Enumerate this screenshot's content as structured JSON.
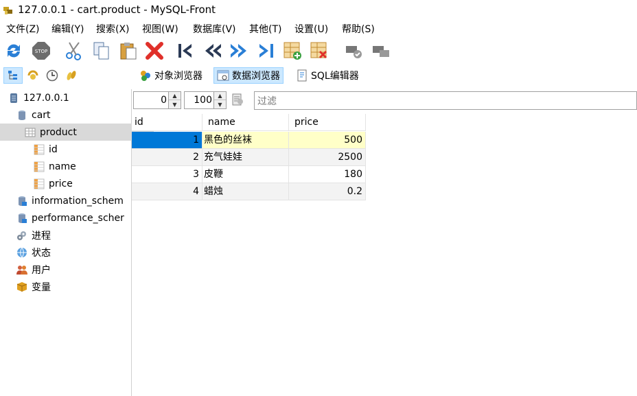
{
  "window": {
    "title": "127.0.0.1 - cart.product - MySQL-Front"
  },
  "menu": [
    "文件(Z)",
    "编辑(Y)",
    "搜索(X)",
    "视图(W)",
    "数据库(V)",
    "其他(T)",
    "设置(U)",
    "帮助(S)"
  ],
  "viewbar": {
    "object_browser": "对象浏览器",
    "data_browser": "数据浏览器",
    "sql_editor": "SQL编辑器"
  },
  "tree": {
    "host": "127.0.0.1",
    "db_cart": "cart",
    "table_product": "product",
    "col_id": "id",
    "col_name": "name",
    "col_price": "price",
    "db_info": "information_schem",
    "db_perf": "performance_scher",
    "processes": "进程",
    "status": "状态",
    "users": "用户",
    "variables": "变量"
  },
  "nav": {
    "offset": "0",
    "limit": "100",
    "filter_placeholder": "过滤"
  },
  "grid": {
    "columns": [
      "id",
      "name",
      "price"
    ],
    "rows": [
      {
        "id": "1",
        "name": "黑色的丝袜",
        "price": "500"
      },
      {
        "id": "2",
        "name": "充气娃娃",
        "price": "2500"
      },
      {
        "id": "3",
        "name": "皮鞭",
        "price": "180"
      },
      {
        "id": "4",
        "name": "蜡烛",
        "price": "0.2"
      }
    ]
  },
  "colors": {
    "selection": "#0078d7",
    "highlight": "#ffffc8",
    "active_tab": "#cce8ff"
  }
}
